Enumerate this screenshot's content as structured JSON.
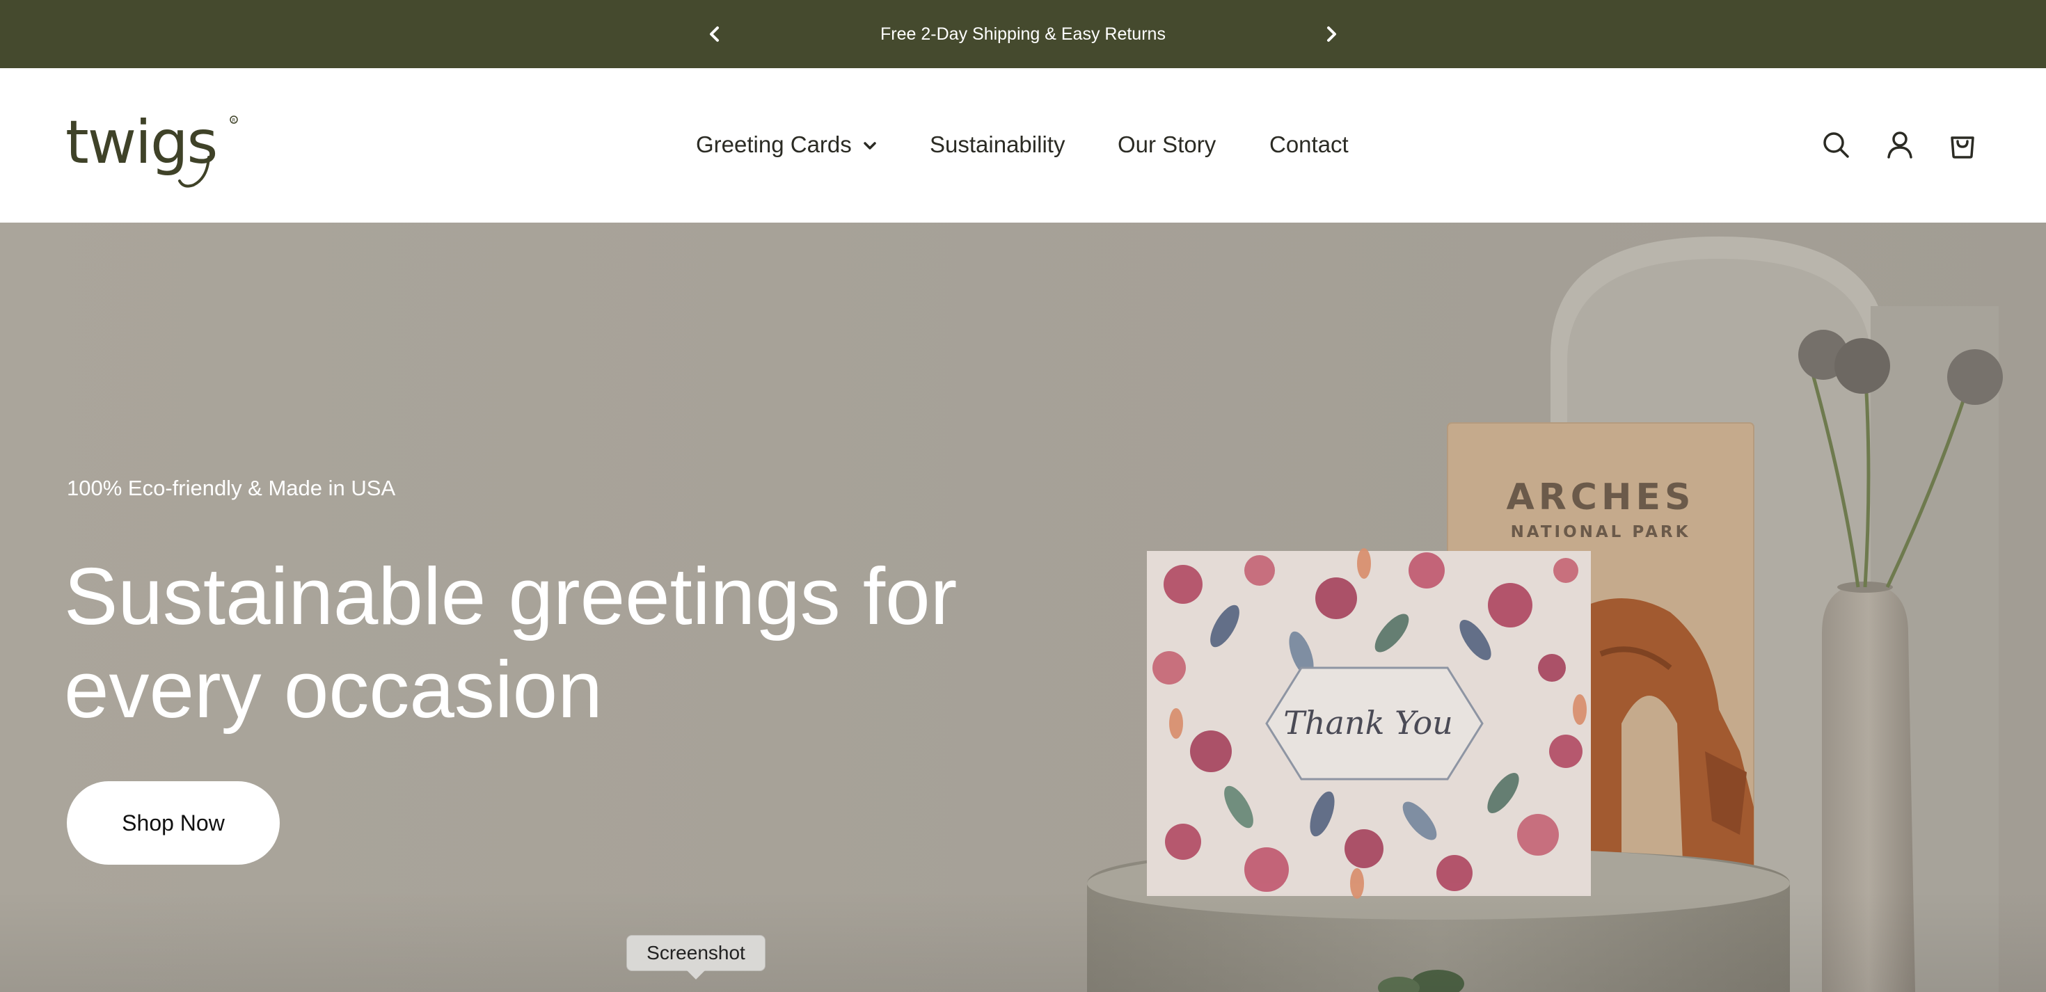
{
  "announcement": {
    "message": "Free 2-Day Shipping & Easy Returns",
    "prev_icon": "chevron-left-icon",
    "next_icon": "chevron-right-icon"
  },
  "header": {
    "logo_text": "twigs",
    "nav": [
      {
        "label": "Greeting Cards",
        "has_dropdown": true
      },
      {
        "label": "Sustainability"
      },
      {
        "label": "Our Story"
      },
      {
        "label": "Contact"
      }
    ],
    "icons": [
      "search-icon",
      "account-icon",
      "cart-icon"
    ]
  },
  "hero": {
    "eyebrow": "100% Eco-friendly & Made in USA",
    "headline": "Sustainable greetings for every occasion",
    "cta_label": "Shop Now",
    "card_front_text": "Thank You",
    "card_back_title": "ARCHES",
    "card_back_subtitle": "NATIONAL PARK"
  },
  "tooltip": {
    "text": "Screenshot"
  },
  "colors": {
    "announcement_bg": "#454a2e",
    "hero_bg": "#aaa59b",
    "text_dark": "#2b2b24"
  }
}
